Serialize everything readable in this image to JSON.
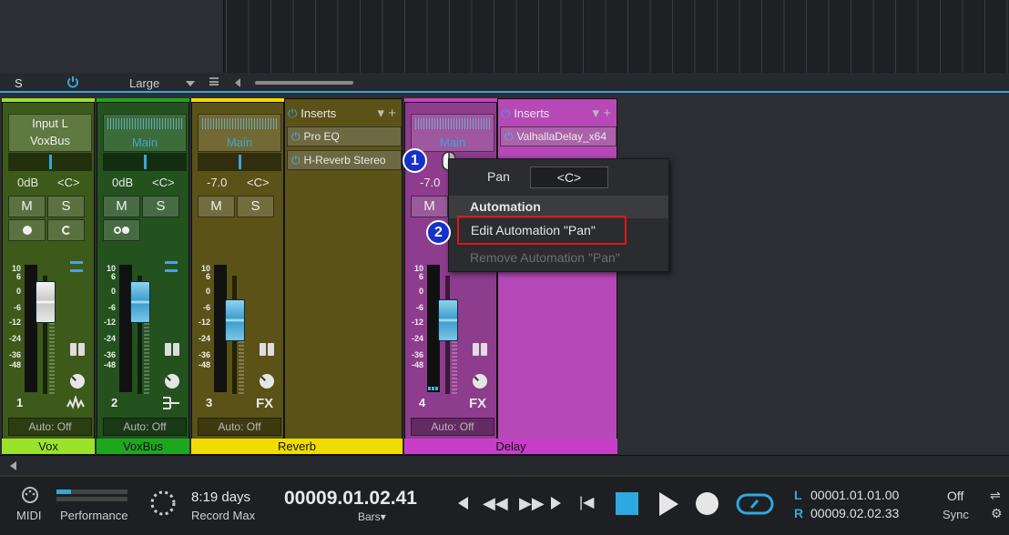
{
  "toolbar": {
    "s_label": "S",
    "size_label": "Large"
  },
  "channels": [
    {
      "num": "1",
      "input": "Input L",
      "output": "VoxBus",
      "volume": "0dB",
      "pan": "<C>",
      "mute": "M",
      "solo": "S",
      "auto": "Auto: Off",
      "name": "Vox",
      "color": "#9be22b",
      "body": "#3d5a1a",
      "fader": "white",
      "type_icon": "wave-icon"
    },
    {
      "num": "2",
      "output": "Main",
      "volume": "0dB",
      "pan": "<C>",
      "mute": "M",
      "solo": "S",
      "auto": "Auto: Off",
      "name": "VoxBus",
      "color": "#1fa61f",
      "body": "#23521f",
      "fader": "blue",
      "type_icon": "bus-icon"
    },
    {
      "num": "3",
      "output": "Main",
      "volume": "-7.0",
      "pan": "<C>",
      "mute": "M",
      "solo": "S",
      "auto": "Auto: Off",
      "name": "Reverb",
      "color": "#f0dc00",
      "body": "#5b5218",
      "fader": "blue",
      "type_icon": "FX"
    },
    {
      "num": "4",
      "output": "Main",
      "volume": "-7.0",
      "mute": "M",
      "auto": "Auto: Off",
      "name": "Delay",
      "color": "#c83ec8",
      "body": "#8e3d8e",
      "fader": "blue",
      "type_icon": "FX"
    }
  ],
  "inserts": [
    {
      "header": "Inserts",
      "slots": [
        "Pro EQ",
        "H-Reverb Stereo"
      ]
    },
    {
      "header": "Inserts",
      "slots": [
        "ValhallaDelay_x64"
      ]
    }
  ],
  "scale": [
    "10",
    "6",
    "0",
    "-6",
    "-12",
    "-24",
    "-36",
    "-48"
  ],
  "popup": {
    "pan_label": "Pan",
    "pan_value": "<C>",
    "section": "Automation",
    "edit": "Edit Automation \"Pan\"",
    "remove": "Remove Automation \"Pan\""
  },
  "badges": [
    "1",
    "2"
  ],
  "transport": {
    "midi": "MIDI",
    "performance": "Performance",
    "record_time": "8:19 days",
    "record_max": "Record Max",
    "position": "00009.01.02.41",
    "position_unit": "Bars",
    "loop_l_label": "L",
    "loop_l": "00001.01.01.00",
    "loop_r_label": "R",
    "loop_r": "00009.02.02.33",
    "sync_state": "Off",
    "sync_label": "Sync"
  },
  "colors": {
    "accent": "#3aa6d8",
    "highlight": "#e01515",
    "badge": "#1431c8"
  }
}
